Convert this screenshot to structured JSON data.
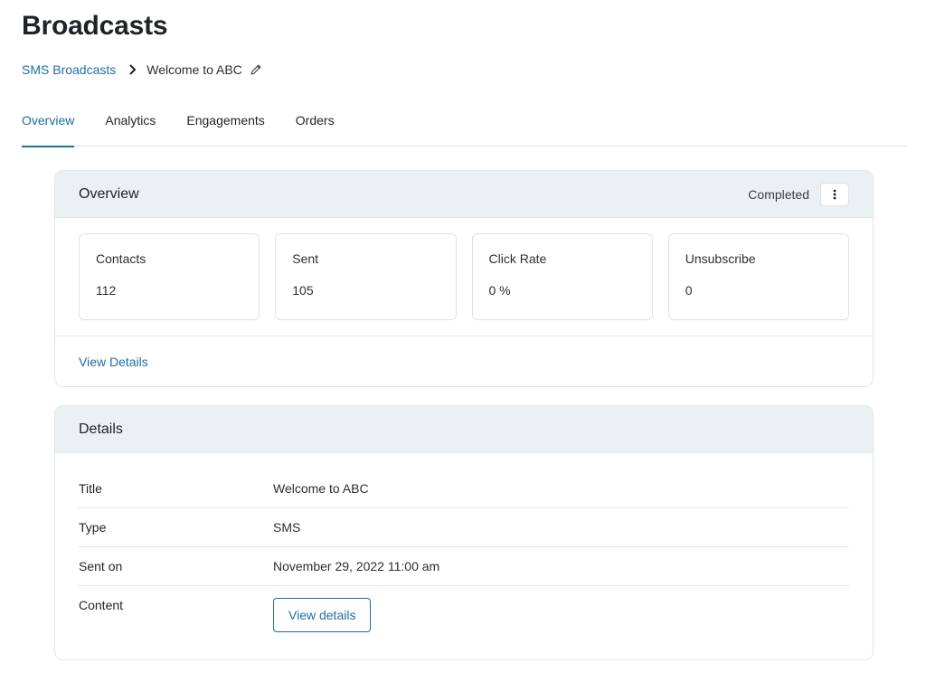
{
  "page": {
    "title": "Broadcasts"
  },
  "breadcrumb": {
    "parent": "SMS Broadcasts",
    "current": "Welcome to ABC"
  },
  "tabs": [
    {
      "label": "Overview",
      "active": true
    },
    {
      "label": "Analytics",
      "active": false
    },
    {
      "label": "Engagements",
      "active": false
    },
    {
      "label": "Orders",
      "active": false
    }
  ],
  "overview": {
    "title": "Overview",
    "status": "Completed",
    "stats": [
      {
        "label": "Contacts",
        "value": "112"
      },
      {
        "label": "Sent",
        "value": "105"
      },
      {
        "label": "Click Rate",
        "value": "0 %"
      },
      {
        "label": "Unsubscribe",
        "value": "0"
      }
    ],
    "view_details_link": "View Details"
  },
  "details": {
    "title": "Details",
    "rows": [
      {
        "label": "Title",
        "value": "Welcome to ABC"
      },
      {
        "label": "Type",
        "value": "SMS"
      },
      {
        "label": "Sent on",
        "value": "November 29, 2022 11:00 am"
      },
      {
        "label": "Content",
        "button_label": "View details"
      }
    ]
  },
  "colors": {
    "accent": "#1f6f9f",
    "header_bg": "#ebf0f3",
    "border": "#e2e5e9"
  },
  "icons": {
    "breadcrumb_separator": "chevron-right-icon",
    "edit": "pencil-icon",
    "more": "more-vertical-icon"
  }
}
